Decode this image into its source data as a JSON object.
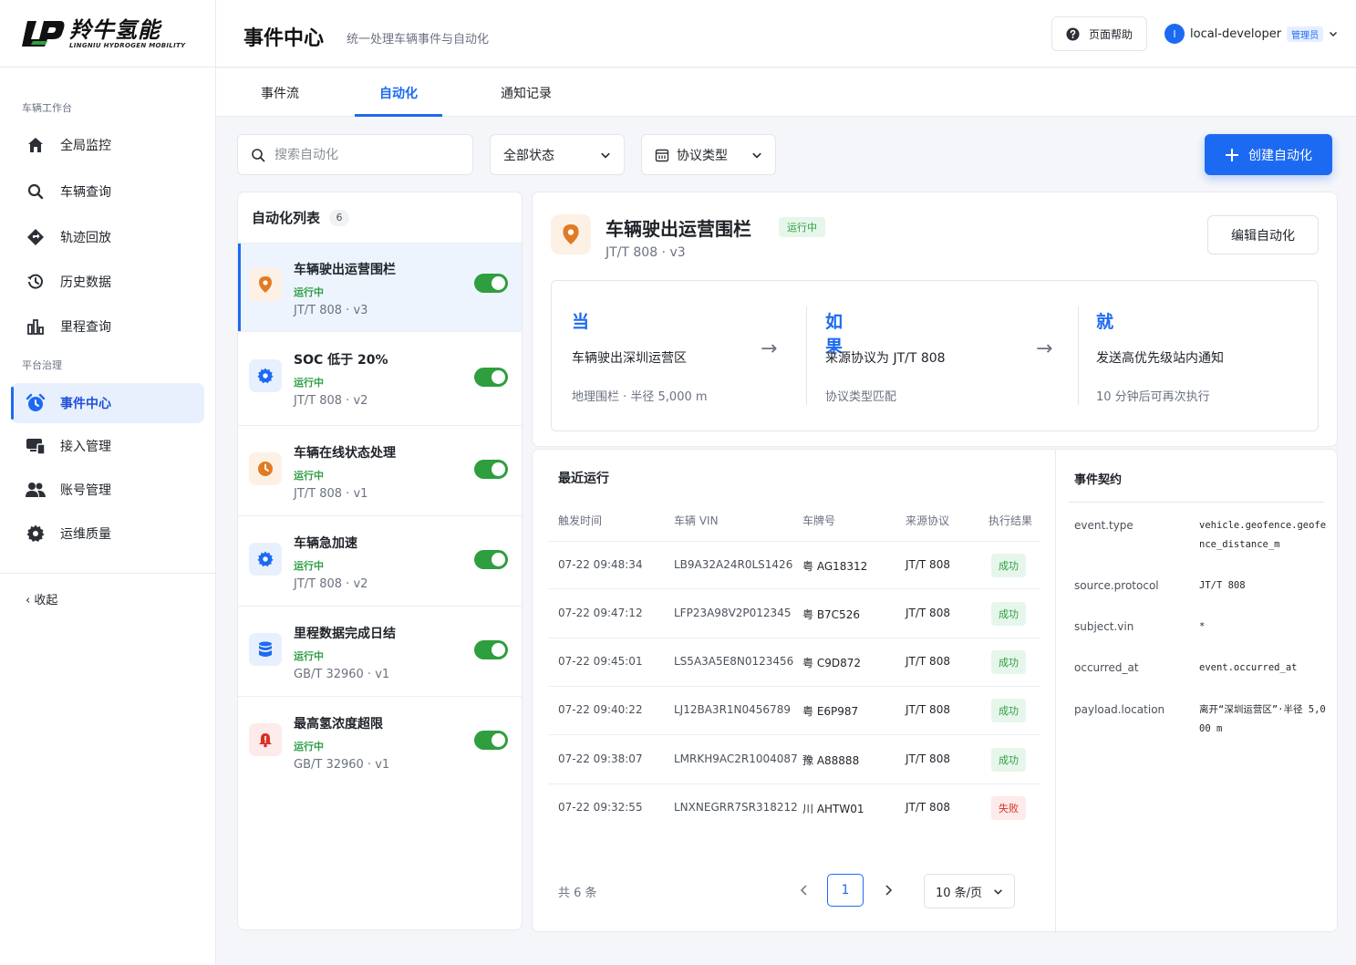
{
  "brand": {
    "name_cn": "羚牛氢能",
    "name_en": "LINGNIU HYDROGEN MOBILITY",
    "mark": "LP"
  },
  "sidebar": {
    "section_vehicle": "车辆工作台",
    "items_vehicle": [
      {
        "label": "全局监控",
        "icon": "home-icon"
      },
      {
        "label": "车辆查询",
        "icon": "search-icon"
      },
      {
        "label": "轨迹回放",
        "icon": "route-icon"
      },
      {
        "label": "历史数据",
        "icon": "history-icon"
      },
      {
        "label": "里程查询",
        "icon": "bar-chart-icon"
      }
    ],
    "section_platform": "平台治理",
    "items_platform": [
      {
        "label": "事件中心",
        "icon": "alarm-clock-icon",
        "active": true
      },
      {
        "label": "接入管理",
        "icon": "devices-icon"
      },
      {
        "label": "账号管理",
        "icon": "users-icon"
      },
      {
        "label": "运维质量",
        "icon": "gear-icon"
      }
    ],
    "collapse": "收起"
  },
  "header": {
    "title": "事件中心",
    "subtitle": "统一处理车辆事件与自动化",
    "help": "页面帮助",
    "user": {
      "initial": "l",
      "name": "local-developer",
      "role": "管理员"
    }
  },
  "tabs": [
    {
      "label": "事件流"
    },
    {
      "label": "自动化",
      "active": true
    },
    {
      "label": "通知记录"
    }
  ],
  "filters": {
    "search_placeholder": "搜索自动化",
    "status": "全部状态",
    "protocol": "协议类型",
    "create": "创建自动化"
  },
  "automation_list": {
    "title": "自动化列表",
    "count": "6",
    "items": [
      {
        "name": "车辆驶出运营围栏",
        "status": "运行中",
        "protocol": "JT/T 808 · v3",
        "icon": "location-pin-icon",
        "icon_color": "#e07b24",
        "icon_bg": "#fdf1e6",
        "enabled": true,
        "selected": true
      },
      {
        "name": "SOC 低于 20%",
        "status": "运行中",
        "protocol": "JT/T 808 · v2",
        "icon": "gear-icon",
        "icon_color": "#1d6af2",
        "icon_bg": "#e8f0fd",
        "enabled": true
      },
      {
        "name": "车辆在线状态处理",
        "status": "运行中",
        "protocol": "JT/T 808 · v1",
        "icon": "clock-icon",
        "icon_color": "#e07b24",
        "icon_bg": "#fdf1e6",
        "enabled": true
      },
      {
        "name": "车辆急加速",
        "status": "运行中",
        "protocol": "JT/T 808 · v2",
        "icon": "gear-icon",
        "icon_color": "#1d6af2",
        "icon_bg": "#e8f0fd",
        "enabled": true
      },
      {
        "name": "里程数据完成日结",
        "status": "运行中",
        "protocol": "GB/T 32960 · v1",
        "icon": "database-icon",
        "icon_color": "#1d6af2",
        "icon_bg": "#e8f0fd",
        "enabled": true
      },
      {
        "name": "最高氢浓度超限",
        "status": "运行中",
        "protocol": "GB/T 32960 · v1",
        "icon": "bell-icon",
        "icon_color": "#d93025",
        "icon_bg": "#fdeaea",
        "enabled": true
      }
    ]
  },
  "detail": {
    "title": "车辆驶出运营围栏",
    "status": "运行中",
    "protocol": "JT/T 808 · v3",
    "edit": "编辑自动化",
    "when": {
      "label": "当",
      "main": "车辆驶出深圳运营区",
      "sub": "地理围栏 · 半径 5,000 m"
    },
    "if": {
      "label": "如果",
      "main": "来源协议为 JT/T 808",
      "sub": "协议类型匹配"
    },
    "then": {
      "label": "就",
      "main": "发送高优先级站内通知",
      "sub": "10 分钟后可再次执行"
    }
  },
  "runs": {
    "title": "最近运行",
    "columns": [
      "触发时间",
      "车辆 VIN",
      "车牌号",
      "来源协议",
      "执行结果"
    ],
    "rows": [
      {
        "time": "07-22 09:48:34",
        "vin": "LB9A32A24R0LS1426",
        "plate": "粤 AG18312",
        "proto": "JT/T 808",
        "result": "成功",
        "ok": true
      },
      {
        "time": "07-22 09:47:12",
        "vin": "LFP23A98V2P012345",
        "plate": "粤 B7C526",
        "proto": "JT/T 808",
        "result": "成功",
        "ok": true
      },
      {
        "time": "07-22 09:45:01",
        "vin": "LS5A3A5E8N0123456",
        "plate": "粤 C9D872",
        "proto": "JT/T 808",
        "result": "成功",
        "ok": true
      },
      {
        "time": "07-22 09:40:22",
        "vin": "LJ12BA3R1N0456789",
        "plate": "粤 E6P987",
        "proto": "JT/T 808",
        "result": "成功",
        "ok": true
      },
      {
        "time": "07-22 09:38:07",
        "vin": "LMRKH9AC2R1004087",
        "plate": "豫 A88888",
        "proto": "JT/T 808",
        "result": "成功",
        "ok": true
      },
      {
        "time": "07-22 09:32:55",
        "vin": "LNXNEGRR7SR318212",
        "plate": "川 AHTW01",
        "proto": "JT/T 808",
        "result": "失败",
        "ok": false
      }
    ],
    "total": "共 6 条",
    "page": "1",
    "page_size": "10 条/页"
  },
  "contract": {
    "title": "事件契约",
    "fields": [
      {
        "key": "event.type",
        "value": "vehicle.geofence.geofence_distance_m"
      },
      {
        "key": "source.protocol",
        "value": "JT/T 808"
      },
      {
        "key": "subject.vin",
        "value": "*"
      },
      {
        "key": "occurred_at",
        "value": "event.occurred_at"
      },
      {
        "key": "payload.location",
        "value": "离开“深圳运营区”·半径 5,000 m"
      }
    ]
  },
  "colors": {
    "accent": "#1d6af2",
    "success": "#2f9e44",
    "danger": "#d93025",
    "warning": "#e07b24"
  }
}
